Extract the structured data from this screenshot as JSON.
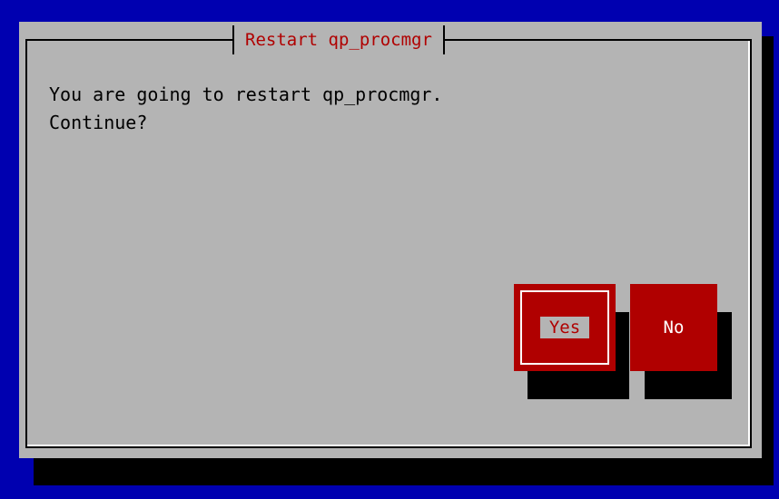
{
  "dialog": {
    "title": "Restart qp_procmgr",
    "message_line1": "You are going to restart qp_procmgr.",
    "message_line2": "Continue?"
  },
  "buttons": {
    "yes_label": "Yes",
    "no_label": "No",
    "focused": "Yes"
  },
  "colors": {
    "background": "#0000b0",
    "dialog": "#b4b4b4",
    "accent": "#b00000",
    "text": "#000000",
    "shadow": "#000000"
  }
}
